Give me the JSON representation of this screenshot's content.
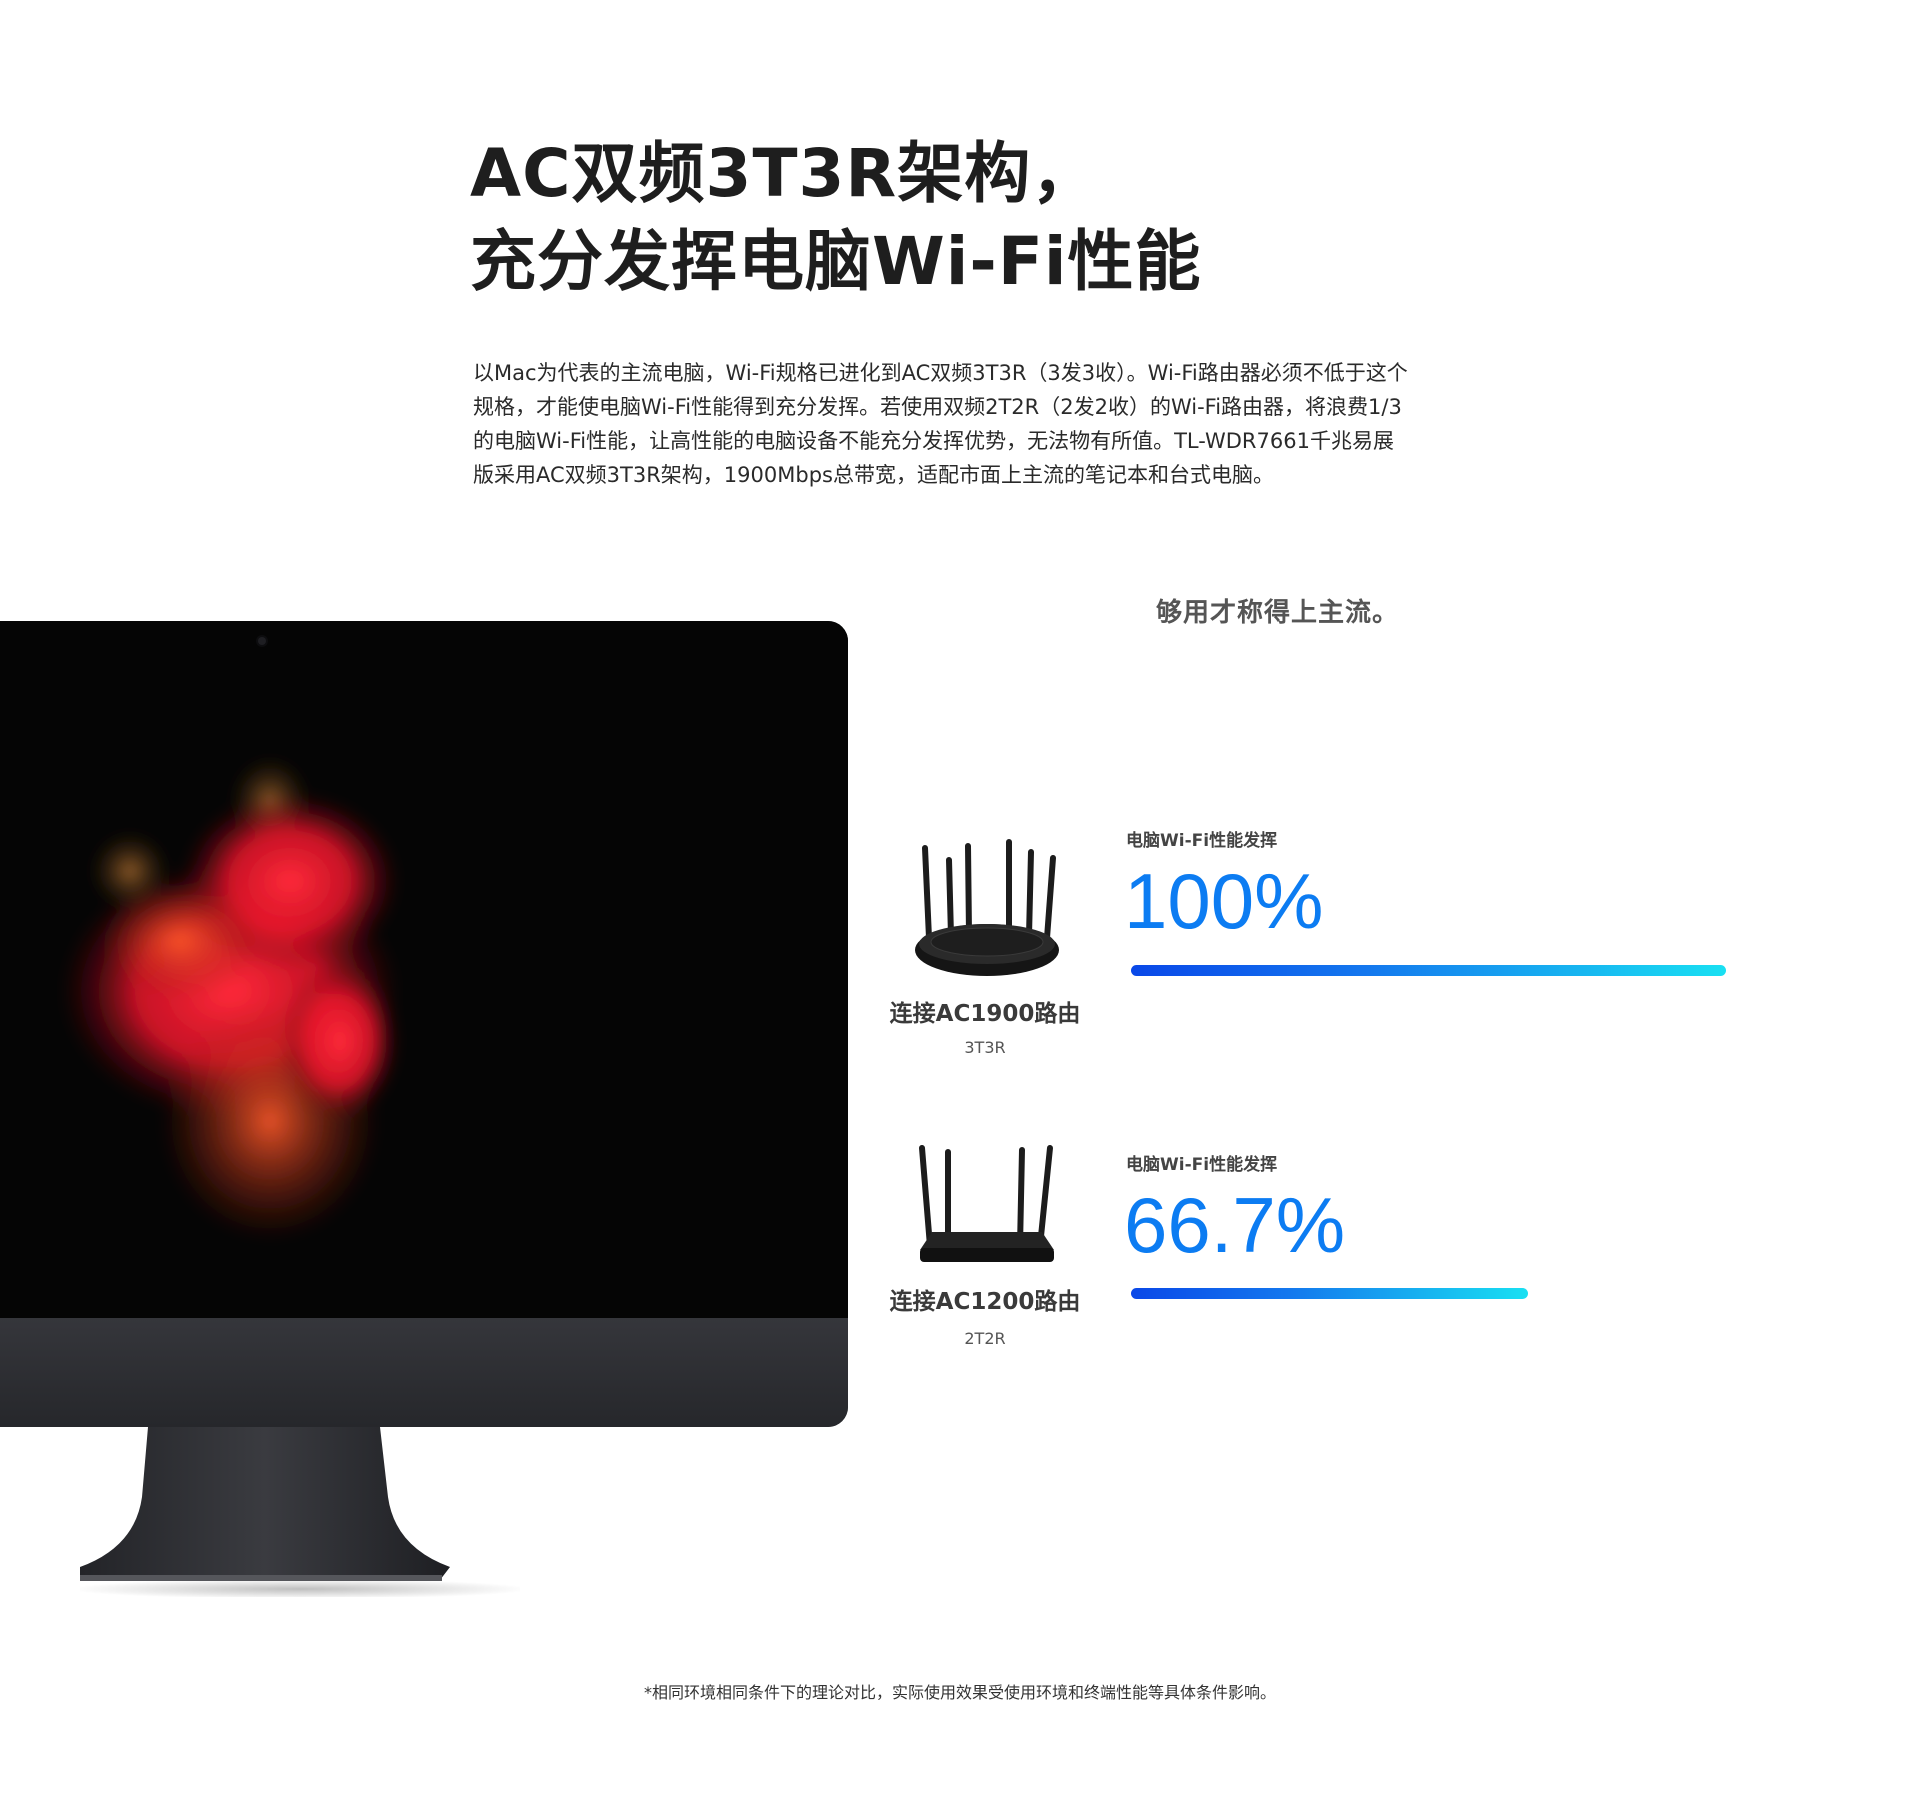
{
  "heading": {
    "line1": "AC双频3T3R架构，",
    "line2": "充分发挥电脑Wi-Fi性能"
  },
  "intro": "以Mac为代表的主流电脑，Wi-Fi规格已进化到AC双频3T3R（3发3收）。Wi-Fi路由器必须不低于这个规格，才能使电脑Wi-Fi性能得到充分发挥。若使用双频2T2R（2发2收）的Wi-Fi路由器，将浪费1/3的电脑Wi-Fi性能，让高性能的电脑设备不能充分发挥优势，无法物有所值。TL-WDR7661千兆易展版采用AC双频3T3R架构，1900Mbps总带宽，适配市面上主流的笔记本和台式电脑。",
  "tagline": "够用才称得上主流。",
  "comparisons": [
    {
      "router_name": "连接AC1900路由",
      "spec": "3T3R",
      "perf_label": "电脑Wi-Fi性能发挥",
      "perf_value": "100%",
      "perf_fraction": 1.0
    },
    {
      "router_name": "连接AC1200路由",
      "spec": "2T2R",
      "perf_label": "电脑Wi-Fi性能发挥",
      "perf_value": "66.7%",
      "perf_fraction": 0.667
    }
  ],
  "colors": {
    "accent": "#0c7cf2",
    "bar_start": "#0a48e8",
    "bar_end": "#19e0f2"
  },
  "footnote": "*相同环境相同条件下的理论对比，实际使用效果受使用环境和终端性能等具体条件影响。"
}
